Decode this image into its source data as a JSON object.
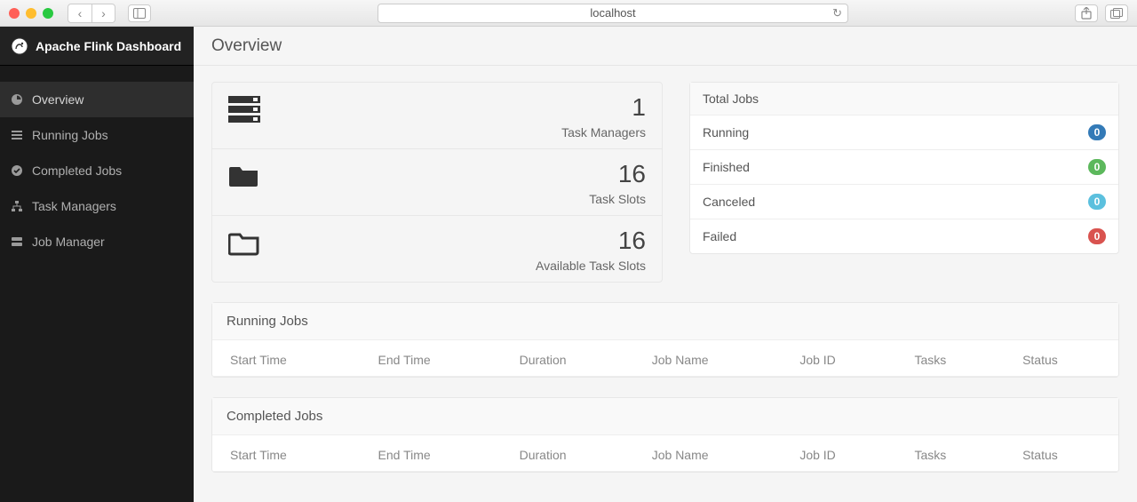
{
  "browser": {
    "url": "localhost"
  },
  "brand": {
    "title": "Apache Flink Dashboard"
  },
  "sidebar": {
    "items": [
      {
        "label": "Overview",
        "active": true
      },
      {
        "label": "Running Jobs",
        "active": false
      },
      {
        "label": "Completed Jobs",
        "active": false
      },
      {
        "label": "Task Managers",
        "active": false
      },
      {
        "label": "Job Manager",
        "active": false
      }
    ]
  },
  "page": {
    "title": "Overview"
  },
  "stats": {
    "task_managers": {
      "value": "1",
      "label": "Task Managers"
    },
    "task_slots": {
      "value": "16",
      "label": "Task Slots"
    },
    "avail_slots": {
      "value": "16",
      "label": "Available Task Slots"
    }
  },
  "totals": {
    "header": "Total Jobs",
    "rows": [
      {
        "label": "Running",
        "count": "0",
        "color": "#337ab7"
      },
      {
        "label": "Finished",
        "count": "0",
        "color": "#5cb85c"
      },
      {
        "label": "Canceled",
        "count": "0",
        "color": "#5bc0de"
      },
      {
        "label": "Failed",
        "count": "0",
        "color": "#d9534f"
      }
    ]
  },
  "running_jobs": {
    "header": "Running Jobs",
    "columns": [
      "Start Time",
      "End Time",
      "Duration",
      "Job Name",
      "Job ID",
      "Tasks",
      "Status"
    ]
  },
  "completed_jobs": {
    "header": "Completed Jobs",
    "columns": [
      "Start Time",
      "End Time",
      "Duration",
      "Job Name",
      "Job ID",
      "Tasks",
      "Status"
    ]
  }
}
